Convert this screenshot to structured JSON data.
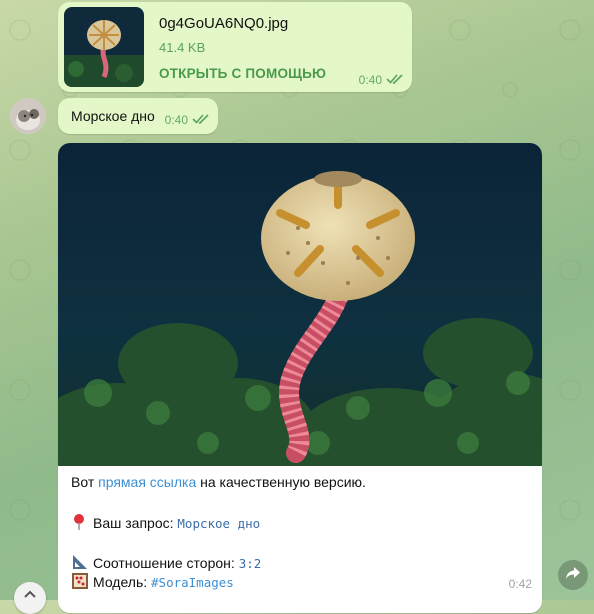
{
  "file_message": {
    "file_name": "0g4GoUA6NQ0.jpg",
    "file_size": "41.4 KB",
    "open_with_label": "ОТКРЫТЬ С ПОМОЩЬЮ",
    "time": "0:40"
  },
  "text_message": {
    "text": "Морское дно",
    "time": "0:40"
  },
  "bot_message": {
    "intro_prefix": "Вот ",
    "intro_link": "прямая ссылка",
    "intro_suffix": " на качественную версию.",
    "query_label": "Ваш запрос:",
    "query_value": "Морское дно",
    "ratio_label": "Соотношение сторон:",
    "ratio_value": "3:2",
    "model_label": "Модель:",
    "model_value": "#SoraImages",
    "time": "0:42"
  },
  "colors": {
    "outgoing_bubble": "#e3f7c8",
    "link": "#3d8fd1",
    "read_check": "#5aa35a"
  },
  "icons": {
    "read": "double-check-icon",
    "pin": "round-pushpin-icon",
    "ruler": "triangular-ruler-icon",
    "model": "abacus-icon",
    "share": "share-arrow-icon",
    "scroll": "scroll-down-icon"
  }
}
